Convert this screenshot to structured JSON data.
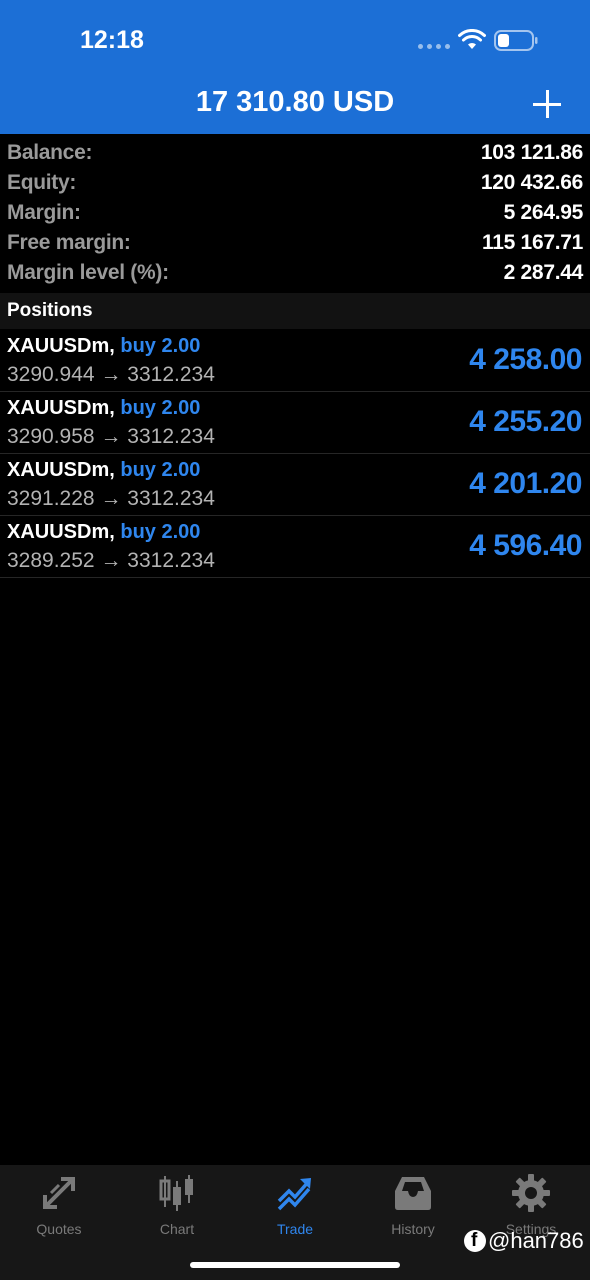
{
  "status_bar": {
    "time": "12:18"
  },
  "header": {
    "title": "17 310.80 USD"
  },
  "summary": [
    {
      "label": "Balance:",
      "value": "103 121.86"
    },
    {
      "label": "Equity:",
      "value": "120 432.66"
    },
    {
      "label": "Margin:",
      "value": "5 264.95"
    },
    {
      "label": "Free margin:",
      "value": "115 167.71"
    },
    {
      "label": "Margin level (%):",
      "value": "2 287.44"
    }
  ],
  "positions_header": "Positions",
  "positions": [
    {
      "symbol": "XAUUSDm,",
      "side": "buy 2.00",
      "open_price": "3290.944",
      "arrow": "→",
      "current_price": "3312.234",
      "profit": "4 258.00"
    },
    {
      "symbol": "XAUUSDm,",
      "side": "buy 2.00",
      "open_price": "3290.958",
      "arrow": "→",
      "current_price": "3312.234",
      "profit": "4 255.20"
    },
    {
      "symbol": "XAUUSDm,",
      "side": "buy 2.00",
      "open_price": "3291.228",
      "arrow": "→",
      "current_price": "3312.234",
      "profit": "4 201.20"
    },
    {
      "symbol": "XAUUSDm,",
      "side": "buy 2.00",
      "open_price": "3289.252",
      "arrow": "→",
      "current_price": "3312.234",
      "profit": "4 596.40"
    }
  ],
  "tabs": [
    {
      "label": "Quotes",
      "icon": "quotes-arrows-icon"
    },
    {
      "label": "Chart",
      "icon": "candlestick-icon"
    },
    {
      "label": "Trade",
      "icon": "trade-trend-icon",
      "active": true
    },
    {
      "label": "History",
      "icon": "inbox-icon"
    },
    {
      "label": "Settings",
      "icon": "gear-icon"
    }
  ],
  "watermark": "@han786",
  "colors": {
    "header_bg": "#1c6fd6",
    "accent": "#2f86ee",
    "background": "#000000",
    "tabbar_bg": "#171717"
  }
}
